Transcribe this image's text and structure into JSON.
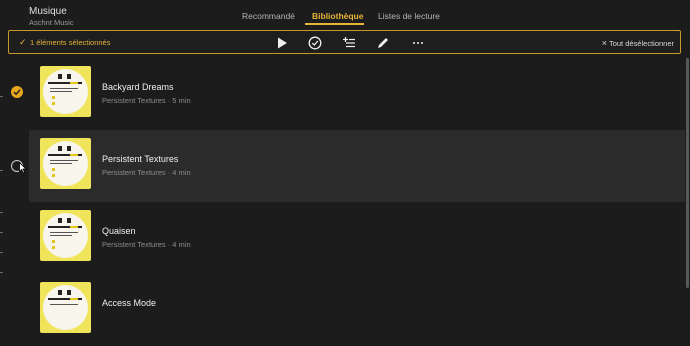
{
  "app": {
    "title": "Musique",
    "subtitle": "Aschnt Music"
  },
  "tabs": [
    {
      "label": "Recommandé",
      "active": false
    },
    {
      "label": "Bibliothèque",
      "active": true
    },
    {
      "label": "Listes de lecture",
      "active": false
    }
  ],
  "selection_bar": {
    "count_label": "1 éléments sélectionnés",
    "deselect_label": "Tout désélectionner",
    "icons": [
      "play-icon",
      "check-circle-icon",
      "add-to-playlist-icon",
      "edit-icon",
      "more-icon",
      "close-icon"
    ]
  },
  "colors": {
    "accent": "#e8b339",
    "background": "#1c1c1c",
    "row_hover": "#2b2b2b",
    "cover_yellow": "#f0e45a"
  },
  "tracks": [
    {
      "title": "Backyard Dreams",
      "subtitle": "Persistent Textures · 5 min",
      "selected": true
    },
    {
      "title": "Persistent Textures",
      "subtitle": "Persistent Textures · 4 min",
      "selected": false,
      "hover": true
    },
    {
      "title": "Quaisen",
      "subtitle": "Persistent Textures · 4 min",
      "selected": false
    },
    {
      "title": "Access Mode",
      "subtitle": "",
      "selected": false
    }
  ]
}
